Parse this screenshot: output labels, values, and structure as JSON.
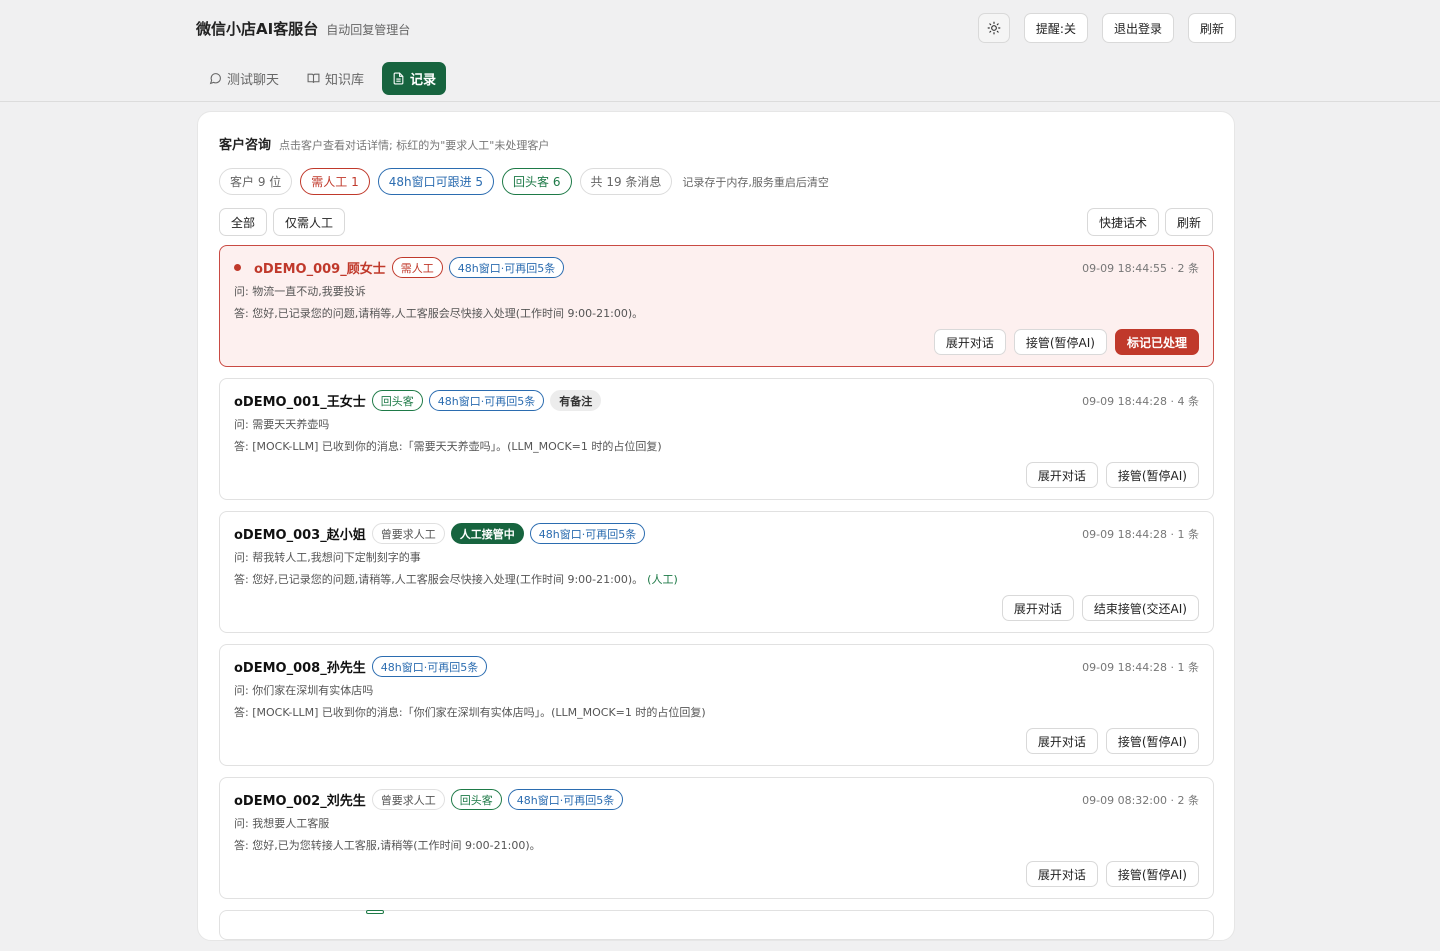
{
  "header": {
    "title": "微信小店AI客服台",
    "subtitle": "自动回复管理台",
    "actions": {
      "theme_icon": "sun-icon",
      "reminder": "提醒:关",
      "logout": "退出登录",
      "refresh": "刷新"
    }
  },
  "tabs": [
    {
      "label": "测试聊天",
      "icon": "chat-bubble-icon",
      "active": false
    },
    {
      "label": "知识库",
      "icon": "book-icon",
      "active": false
    },
    {
      "label": "记录",
      "icon": "document-icon",
      "active": true
    }
  ],
  "panel": {
    "title": "客户咨询",
    "description": "点击客户查看对话详情; 标红的为\"要求人工\"未处理客户",
    "stats": {
      "customers": "客户 9 位",
      "need_human": "需人工 1",
      "window_48h": "48h窗口可跟进 5",
      "returning": "回头客 6",
      "messages": "共 19 条消息",
      "note": "记录存于内存,服务重启后清空"
    },
    "filters": {
      "all": "全部",
      "only_human": "仅需人工"
    },
    "tools": {
      "quick_replies": "快捷话术",
      "refresh": "刷新"
    }
  },
  "customers": [
    {
      "name": "oDEMO_009_顾女士",
      "unread": true,
      "tags": [
        {
          "text": "需人工",
          "style": "red"
        },
        {
          "text": "48h窗口·可再回5条",
          "style": "blue"
        }
      ],
      "meta": "09-09 18:44:55 · 2 条",
      "question": "问: 物流一直不动,我要投诉",
      "answer": "答: 您好,已记录您的问题,请稍等,人工客服会尽快接入处理(工作时间 9:00-21:00)。",
      "answer_note": "",
      "actions": [
        "展开对话",
        "接管(暂停AI)",
        "标记已处理"
      ]
    },
    {
      "name": "oDEMO_001_王女士",
      "unread": false,
      "tags": [
        {
          "text": "回头客",
          "style": "green"
        },
        {
          "text": "48h窗口·可再回5条",
          "style": "blue"
        },
        {
          "text": "有备注",
          "style": "gray"
        }
      ],
      "meta": "09-09 18:44:28 · 4 条",
      "question": "问: 需要天天养壶吗",
      "answer": "答: [MOCK-LLM] 已收到你的消息:「需要天天养壶吗」。(LLM_MOCK=1 时的占位回复)",
      "answer_note": "",
      "actions": [
        "展开对话",
        "接管(暂停AI)"
      ]
    },
    {
      "name": "oDEMO_003_赵小姐",
      "unread": false,
      "tags": [
        {
          "text": "曾要求人工",
          "style": "plain"
        },
        {
          "text": "人工接管中",
          "style": "dark"
        },
        {
          "text": "48h窗口·可再回5条",
          "style": "blue"
        }
      ],
      "meta": "09-09 18:44:28 · 1 条",
      "question": "问: 帮我转人工,我想问下定制刻字的事",
      "answer": "答: 您好,已记录您的问题,请稍等,人工客服会尽快接入处理(工作时间 9:00-21:00)。",
      "answer_note": "(人工)",
      "actions": [
        "展开对话",
        "结束接管(交还AI)"
      ]
    },
    {
      "name": "oDEMO_008_孙先生",
      "unread": false,
      "tags": [
        {
          "text": "48h窗口·可再回5条",
          "style": "blue"
        }
      ],
      "meta": "09-09 18:44:28 · 1 条",
      "question": "问: 你们家在深圳有实体店吗",
      "answer": "答: [MOCK-LLM] 已收到你的消息:「你们家在深圳有实体店吗」。(LLM_MOCK=1 时的占位回复)",
      "answer_note": "",
      "actions": [
        "展开对话",
        "接管(暂停AI)"
      ]
    },
    {
      "name": "oDEMO_002_刘先生",
      "unread": false,
      "tags": [
        {
          "text": "曾要求人工",
          "style": "plain"
        },
        {
          "text": "回头客",
          "style": "green"
        },
        {
          "text": "48h窗口·可再回5条",
          "style": "blue"
        }
      ],
      "meta": "09-09 08:32:00 · 2 条",
      "question": "问: 我想要人工客服",
      "answer": "答: 您好,已为您转接人工客服,请稍等(工作时间 9:00-21:00)。",
      "answer_note": "",
      "actions": [
        "展开对话",
        "接管(暂停AI)"
      ]
    }
  ]
}
